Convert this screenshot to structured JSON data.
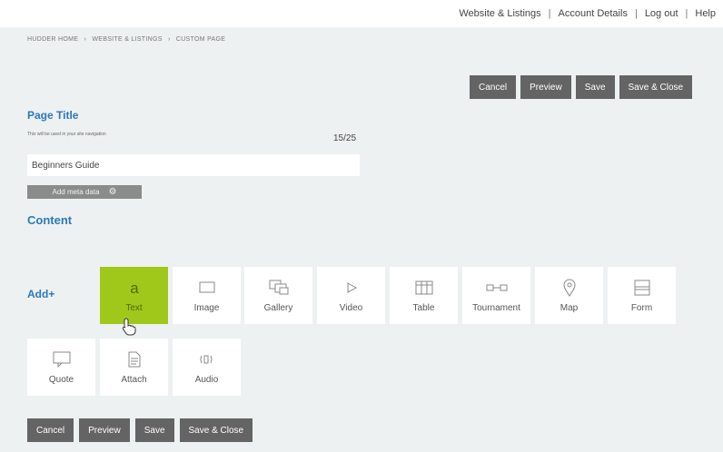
{
  "topnav": {
    "items": [
      "Website & Listings",
      "Account Details",
      "Log out",
      "Help"
    ],
    "separator": "|"
  },
  "breadcrumb": {
    "items": [
      "HUDDER HOME",
      "WEBSITE & LISTINGS",
      "CUSTOM PAGE"
    ],
    "separator": "›"
  },
  "actions": {
    "cancel": "Cancel",
    "preview": "Preview",
    "save": "Save",
    "save_close": "Save & Close"
  },
  "page_title": {
    "heading": "Page Title",
    "help": "This will be used in your site navigation",
    "value": "Beginners Guide",
    "char_count": "15/25",
    "meta_button": "Add meta data"
  },
  "content": {
    "heading": "Content",
    "add_label": "Add+",
    "blocks": [
      {
        "label": "Text",
        "icon": "text-icon",
        "active": true
      },
      {
        "label": "Image",
        "icon": "image-icon"
      },
      {
        "label": "Gallery",
        "icon": "gallery-icon"
      },
      {
        "label": "Video",
        "icon": "video-play-icon"
      },
      {
        "label": "Table",
        "icon": "table-icon"
      },
      {
        "label": "Tournament",
        "icon": "tournament-icon"
      },
      {
        "label": "Map",
        "icon": "map-pin-icon"
      },
      {
        "label": "Form",
        "icon": "form-icon"
      },
      {
        "label": "Quote",
        "icon": "quote-icon"
      },
      {
        "label": "Attach",
        "icon": "attach-icon"
      },
      {
        "label": "Audio",
        "icon": "audio-icon"
      }
    ]
  },
  "colors": {
    "accent": "#2a7ab8",
    "active_tile": "#a0c81a",
    "button": "#646464",
    "background": "#eef1f2"
  }
}
